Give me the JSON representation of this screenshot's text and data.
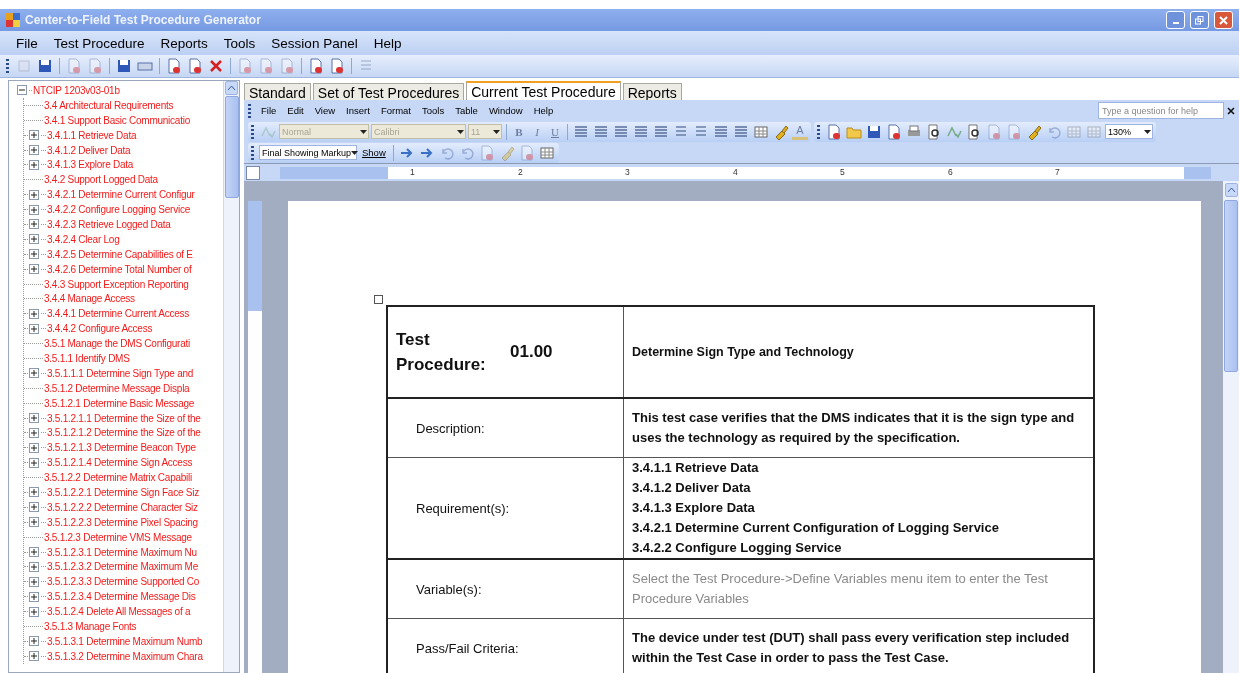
{
  "window": {
    "title": "Center-to-Field Test Procedure Generator"
  },
  "menu": [
    "File",
    "Test Procedure",
    "Reports",
    "Tools",
    "Session Panel",
    "Help"
  ],
  "tree": {
    "label": "NTCIP 1203v03-01b",
    "expanded": true,
    "children": [
      {
        "label": "3.4 Architectural Requirements",
        "kind": "leaf"
      },
      {
        "label": "3.4.1 Support Basic Communicatio",
        "kind": "leaf"
      },
      {
        "label": "3.4.1.1 Retrieve Data",
        "kind": "collapsed"
      },
      {
        "label": "3.4.1.2 Deliver Data",
        "kind": "collapsed"
      },
      {
        "label": "3.4.1.3 Explore Data",
        "kind": "collapsed"
      },
      {
        "label": "3.4.2 Support Logged Data",
        "kind": "leaf"
      },
      {
        "label": "3.4.2.1 Determine Current Configur",
        "kind": "collapsed"
      },
      {
        "label": "3.4.2.2 Configure Logging Service",
        "kind": "collapsed"
      },
      {
        "label": "3.4.2.3 Retrieve Logged Data",
        "kind": "collapsed"
      },
      {
        "label": "3.4.2.4 Clear Log",
        "kind": "collapsed"
      },
      {
        "label": "3.4.2.5 Determine Capabilities of E",
        "kind": "collapsed"
      },
      {
        "label": "3.4.2.6 Determine Total Number of",
        "kind": "collapsed"
      },
      {
        "label": "3.4.3 Support Exception Reporting",
        "kind": "leaf"
      },
      {
        "label": "3.4.4 Manage Access",
        "kind": "leaf"
      },
      {
        "label": "3.4.4.1 Determine Current Access",
        "kind": "collapsed"
      },
      {
        "label": "3.4.4.2 Configure Access",
        "kind": "collapsed"
      },
      {
        "label": "3.5.1 Manage the DMS Configurati",
        "kind": "leaf"
      },
      {
        "label": "3.5.1.1 Identify DMS",
        "kind": "leaf"
      },
      {
        "label": "3.5.1.1.1 Determine Sign Type and",
        "kind": "collapsed"
      },
      {
        "label": "3.5.1.2 Determine Message Displa",
        "kind": "leaf"
      },
      {
        "label": "3.5.1.2.1 Determine Basic Message",
        "kind": "leaf"
      },
      {
        "label": "3.5.1.2.1.1 Determine the Size of the",
        "kind": "collapsed"
      },
      {
        "label": "3.5.1.2.1.2 Determine the Size of the",
        "kind": "collapsed"
      },
      {
        "label": "3.5.1.2.1.3 Determine Beacon Type",
        "kind": "collapsed"
      },
      {
        "label": "3.5.1.2.1.4 Determine Sign Access",
        "kind": "collapsed"
      },
      {
        "label": "3.5.1.2.2 Determine Matrix Capabili",
        "kind": "leaf"
      },
      {
        "label": "3.5.1.2.2.1 Determine Sign Face Siz",
        "kind": "collapsed"
      },
      {
        "label": "3.5.1.2.2.2 Determine Character Siz",
        "kind": "collapsed"
      },
      {
        "label": "3.5.1.2.2.3 Determine Pixel Spacing",
        "kind": "collapsed"
      },
      {
        "label": "3.5.1.2.3 Determine VMS Message",
        "kind": "leaf"
      },
      {
        "label": "3.5.1.2.3.1 Determine Maximum Nu",
        "kind": "collapsed"
      },
      {
        "label": "3.5.1.2.3.2 Determine Maximum Me",
        "kind": "collapsed"
      },
      {
        "label": "3.5.1.2.3.3 Determine Supported Co",
        "kind": "collapsed"
      },
      {
        "label": "3.5.1.2.3.4 Determine Message Dis",
        "kind": "collapsed"
      },
      {
        "label": "3.5.1.2.4 Delete All Messages of a",
        "kind": "collapsed"
      },
      {
        "label": "3.5.1.3 Manage Fonts",
        "kind": "leaf"
      },
      {
        "label": "3.5.1.3.1 Determine Maximum Numb",
        "kind": "collapsed"
      },
      {
        "label": "3.5.1.3.2 Determine Maximum Chara",
        "kind": "collapsed"
      }
    ]
  },
  "tabs": [
    {
      "label": "Standard",
      "selected": false
    },
    {
      "label": "Set of Test Procedures",
      "selected": false
    },
    {
      "label": "Current Test Procedure",
      "selected": true
    },
    {
      "label": "Reports",
      "selected": false
    }
  ],
  "word": {
    "menu": [
      "File",
      "Edit",
      "View",
      "Insert",
      "Format",
      "Tools",
      "Table",
      "Window",
      "Help"
    ],
    "help_field": {
      "placeholder": "Type a question for help"
    },
    "style_box": {
      "value": "Normal",
      "disabled": true
    },
    "font_box": {
      "value": "Calibri",
      "disabled": true
    },
    "size_box": {
      "value": "11",
      "disabled": true
    },
    "format_buttons": [
      "B",
      "I",
      "U"
    ],
    "font_color": "A",
    "zoom_box": {
      "value": "130%"
    },
    "markup_box": {
      "value": "Final Showing Markup"
    },
    "show_button": "Show",
    "ruler_labels": [
      "1",
      "2",
      "3",
      "4",
      "5",
      "6",
      "7"
    ]
  },
  "document": {
    "rows": [
      {
        "kind": "header",
        "label": "Test Procedure:",
        "number": "01.00",
        "value": "Determine Sign Type and Technology"
      },
      {
        "kind": "text",
        "label": "Description:",
        "value": "This test case verifies that the DMS indicates that it is the sign type and uses the technology as required by the specification.",
        "muted": false
      },
      {
        "kind": "list",
        "label": "Requirement(s):",
        "lines": [
          "3.4.1.1 Retrieve Data",
          "3.4.1.2 Deliver Data",
          "3.4.1.3 Explore Data",
          "3.4.2.1 Determine Current Configuration of Logging Service",
          "3.4.2.2 Configure Logging Service"
        ]
      },
      {
        "kind": "text",
        "label": "Variable(s):",
        "value": "Select the Test Procedure->Define Variables menu item to enter the Test Procedure Variables",
        "muted": true
      },
      {
        "kind": "text",
        "label": "Pass/Fail Criteria:",
        "value": "The device under test (DUT) shall pass every verification step included within the Test Case in order to pass the Test Case.",
        "muted": false
      }
    ]
  }
}
